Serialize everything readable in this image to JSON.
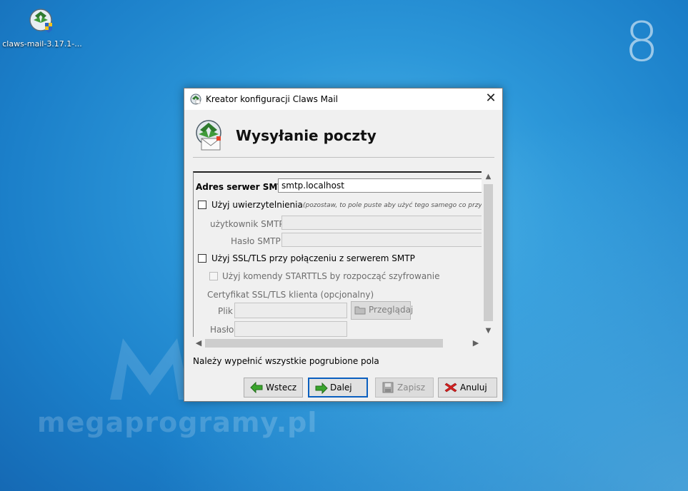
{
  "desktop": {
    "icon_label": "claws-mail-3.17.1-...",
    "corner_digit": "8",
    "watermark": "megaprogramy.pl"
  },
  "dialog": {
    "title": "Kreator konfiguracji Claws Mail",
    "close_glyph": "✕",
    "header_title": "Wysyłanie poczty",
    "smtp_label": "Adres serwer SMTP:",
    "smtp_value": "smtp.localhost",
    "auth_label": "Użyj uwierzytelnienia",
    "auth_note": "(pozostaw, to pole puste aby użyć tego samego co przy od",
    "smtp_user_label": "użytkownik SMTP:",
    "smtp_user_value": "",
    "smtp_pass_label": "Hasło SMTP:",
    "smtp_pass_value": "",
    "ssl_label": "Użyj SSL/TLS przy połączeniu z serwerem SMTP",
    "starttls_label": "Użyj komendy STARTTLS by rozpocząć szyfrowanie",
    "cert_label": "Certyfikat SSL/TLS klienta (opcjonalny)",
    "file_label": "Plik",
    "file_value": "",
    "browse_label": "Przeglądaj",
    "cert_pass_label": "Hasło",
    "cert_pass_value": "",
    "status": "Należy wypełnić wszystkie pogrubione pola",
    "buttons": {
      "back": "Wstecz",
      "next": "Dalej",
      "save": "Zapisz",
      "cancel": "Anuluj"
    }
  },
  "colors": {
    "focus_border": "#0a5fbf",
    "back_arrow": "#3aa52d",
    "cancel_x": "#d42020"
  }
}
